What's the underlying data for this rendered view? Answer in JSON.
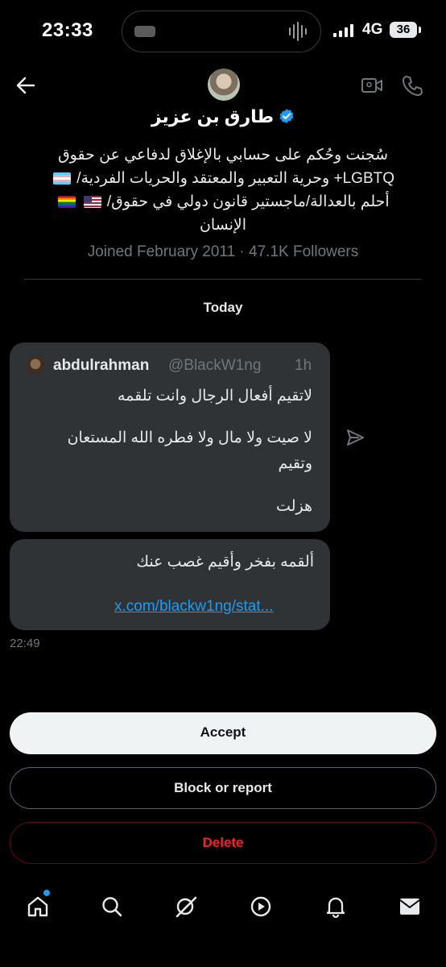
{
  "status_bar": {
    "time": "23:33",
    "network": "4G",
    "battery": "36"
  },
  "header": {
    "display_name": "طارق بن عزيز",
    "bio_lines": [
      "سُجنت وحُكم على حسابي بالإغلاق لدفاعي عن حقوق",
      "LGBTQ+ وحرية التعبير والمعتقد والحريات الفردية/",
      "أحلم بالعدالة/ماجستير قانون دولي في حقوق/",
      "الإنسان"
    ],
    "joined": "Joined February 2011 · 47.1K Followers"
  },
  "conversation": {
    "date_label": "Today",
    "quoted": {
      "name": "abdulrahman",
      "handle": "@BlackW1ng",
      "time": "1h",
      "lines": [
        "لاتقيم أفعال الرجال وانت تلقمه",
        "لا صيت ولا مال ولا فطره الله المستعان",
        "وتقيم",
        "هزلت"
      ]
    },
    "message": {
      "text": "ألقمه بفخر وأقيم غصب عنك",
      "link": "x.com/blackw1ng/stat..."
    },
    "message_time": "22:49"
  },
  "actions": {
    "accept": "Accept",
    "block": "Block or report",
    "delete": "Delete"
  },
  "nav": {
    "icons": [
      "home-icon",
      "search-icon",
      "grok-icon",
      "video-icon",
      "notifications-icon",
      "messages-icon"
    ]
  },
  "colors": {
    "accent": "#1d9bf0",
    "danger": "#f4212e",
    "bubble": "#2f3336",
    "muted": "#71767b"
  }
}
